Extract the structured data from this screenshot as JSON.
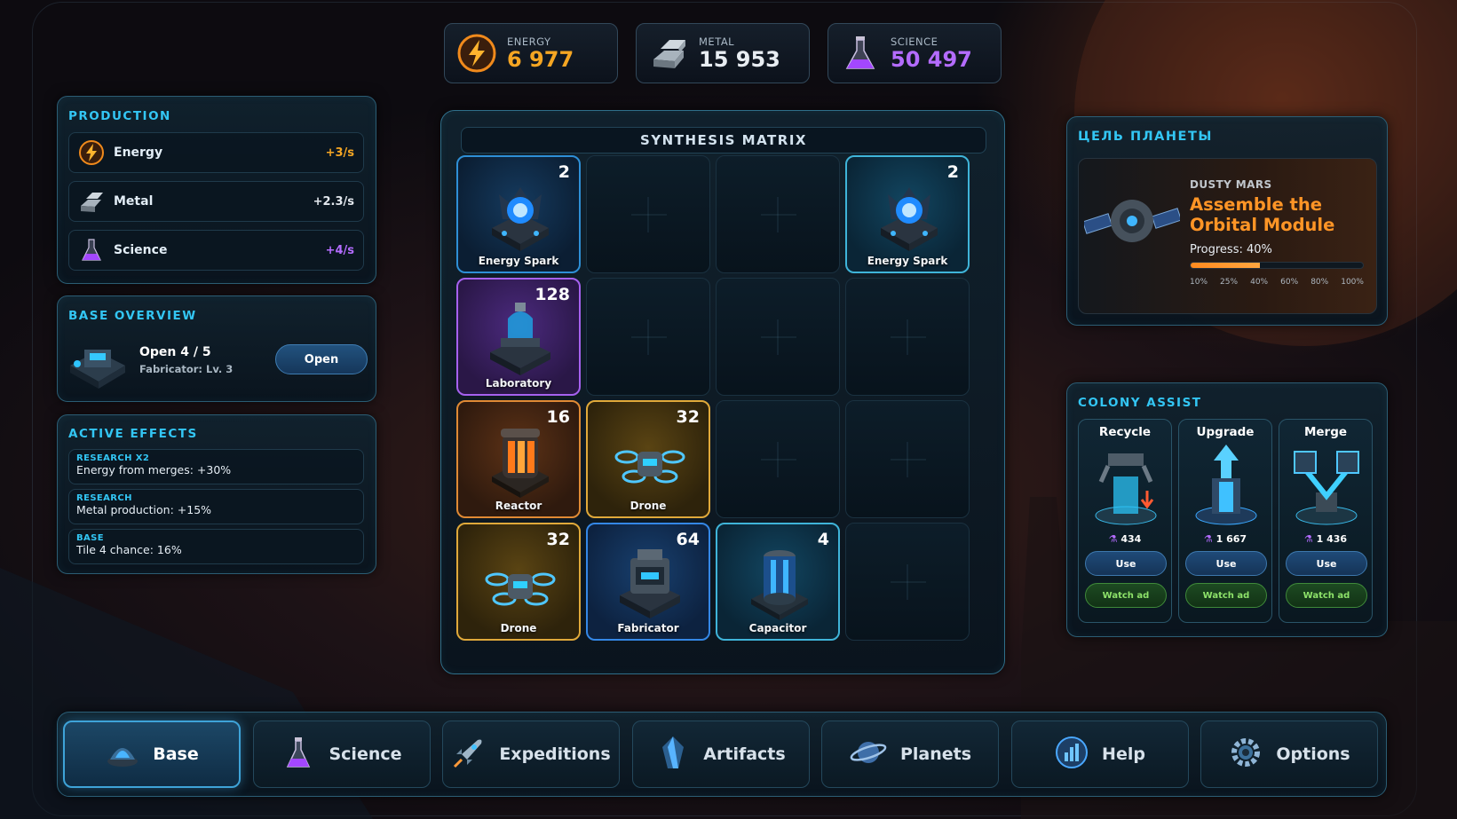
{
  "resources": [
    {
      "label": "ENERGY",
      "value": "6 977",
      "color": "#f5a623",
      "icon": "energy-bolt-icon"
    },
    {
      "label": "METAL",
      "value": "15 953",
      "color": "#e8edf2",
      "icon": "metal-ingot-icon"
    },
    {
      "label": "SCIENCE",
      "value": "50 497",
      "color": "#b46cff",
      "icon": "science-flask-icon"
    }
  ],
  "production": {
    "title": "PRODUCTION",
    "rows": [
      {
        "name": "Energy",
        "rate": "+3/s",
        "color": "#f5a623"
      },
      {
        "name": "Metal",
        "rate": "+2.3/s",
        "color": "#e3e8ee"
      },
      {
        "name": "Science",
        "rate": "+4/s",
        "color": "#b46cff"
      }
    ]
  },
  "base_overview": {
    "title": "BASE OVERVIEW",
    "line1": "Open 4 / 5",
    "line2": "Fabricator: Lv. 3",
    "button": "Open"
  },
  "active_effects": {
    "title": "ACTIVE EFFECTS",
    "items": [
      {
        "tag": "RESEARCH X2",
        "text": "Energy from merges: +30%"
      },
      {
        "tag": "RESEARCH",
        "text": "Metal production: +15%"
      },
      {
        "tag": "BASE",
        "text": "Tile 4 chance: 16%"
      }
    ]
  },
  "matrix": {
    "title": "SYNTHESIS MATRIX",
    "cells": [
      {
        "name": "Energy Spark",
        "level": "2",
        "style": "blue",
        "icon": "energy-spark-icon"
      },
      null,
      null,
      {
        "name": "Energy Spark",
        "level": "2",
        "style": "cyan",
        "icon": "energy-spark-icon"
      },
      {
        "name": "Laboratory",
        "level": "128",
        "style": "purple",
        "icon": "laboratory-icon"
      },
      null,
      null,
      null,
      {
        "name": "Reactor",
        "level": "16",
        "style": "orange",
        "icon": "reactor-icon"
      },
      {
        "name": "Drone",
        "level": "32",
        "style": "gold",
        "icon": "drone-icon"
      },
      null,
      null,
      {
        "name": "Drone",
        "level": "32",
        "style": "gold",
        "icon": "drone-icon"
      },
      {
        "name": "Fabricator",
        "level": "64",
        "style": "dblue",
        "icon": "fabricator-icon"
      },
      {
        "name": "Capacitor",
        "level": "4",
        "style": "cyan",
        "icon": "capacitor-icon"
      },
      null
    ]
  },
  "planet_goal": {
    "title": "ЦЕЛЬ ПЛАНЕТЫ",
    "planet": "DUSTY MARS",
    "goal_line1": "Assemble the",
    "goal_line2": "Orbital Module",
    "progress_label": "Progress: 40%",
    "progress": 0.4,
    "ticks": [
      "10%",
      "25%",
      "40%",
      "60%",
      "80%",
      "100%"
    ]
  },
  "colony_assist": {
    "title": "COLONY ASSIST",
    "cards": [
      {
        "name": "Recycle",
        "cost": "434",
        "use": "Use",
        "ad": "Watch ad",
        "icon": "recycle-machine-icon"
      },
      {
        "name": "Upgrade",
        "cost": "1 667",
        "use": "Use",
        "ad": "Watch ad",
        "icon": "upgrade-tower-icon"
      },
      {
        "name": "Merge",
        "cost": "1 436",
        "use": "Use",
        "ad": "Watch ad",
        "icon": "merge-cubes-icon"
      }
    ]
  },
  "nav": [
    {
      "label": "Base",
      "active": true,
      "icon": "base-dome-icon"
    },
    {
      "label": "Science",
      "active": false,
      "icon": "science-flask-icon"
    },
    {
      "label": "Expeditions",
      "active": false,
      "icon": "rocket-icon"
    },
    {
      "label": "Artifacts",
      "active": false,
      "icon": "crystal-icon"
    },
    {
      "label": "Planets",
      "active": false,
      "icon": "planet-icon"
    },
    {
      "label": "Help",
      "active": false,
      "icon": "help-chart-icon"
    },
    {
      "label": "Options",
      "active": false,
      "icon": "gear-icon"
    }
  ]
}
